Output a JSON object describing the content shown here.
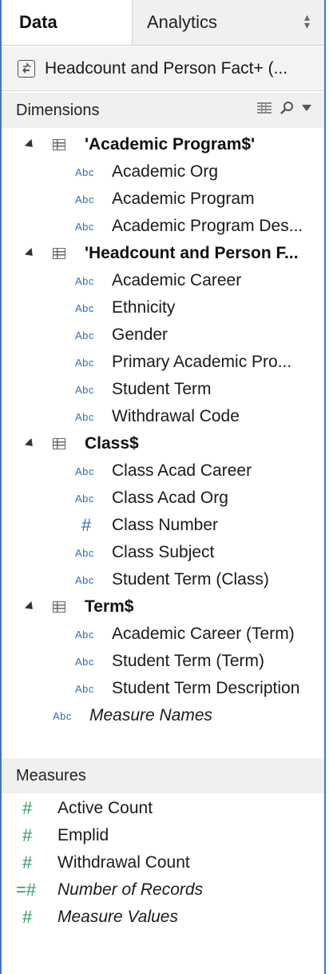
{
  "tabs": {
    "data": "Data",
    "analytics": "Analytics"
  },
  "datasource": {
    "label": "Headcount and Person Fact+ (..."
  },
  "dimensions": {
    "header": "Dimensions",
    "groups": [
      {
        "label": "'Academic Program$'",
        "fields": [
          "Academic Org",
          "Academic Program",
          "Academic Program Des..."
        ]
      },
      {
        "label": "'Headcount and Person F...",
        "fields": [
          "Academic Career",
          "Ethnicity",
          "Gender",
          "Primary Academic Pro...",
          "Student Term",
          "Withdrawal Code"
        ]
      },
      {
        "label": "Class$",
        "fields": [
          "Class Acad Career",
          "Class Acad Org",
          "Class Number",
          "Class Subject",
          "Student Term (Class)"
        ]
      },
      {
        "label": "Term$",
        "fields": [
          "Academic Career (Term)",
          "Student Term (Term)",
          "Student Term Description"
        ]
      }
    ],
    "measure_names": "Measure Names",
    "type_abc": "Abc",
    "type_hash": "#"
  },
  "measures": {
    "header": "Measures",
    "items": [
      "Active Count",
      "Emplid",
      "Withdrawal Count",
      "Number of Records",
      "Measure Values"
    ],
    "type_hash": "#"
  },
  "colors": {
    "accent_border": "#3c78c8",
    "dimension_icon": "#2e6fb5",
    "measure_icon": "#2a9d62"
  }
}
